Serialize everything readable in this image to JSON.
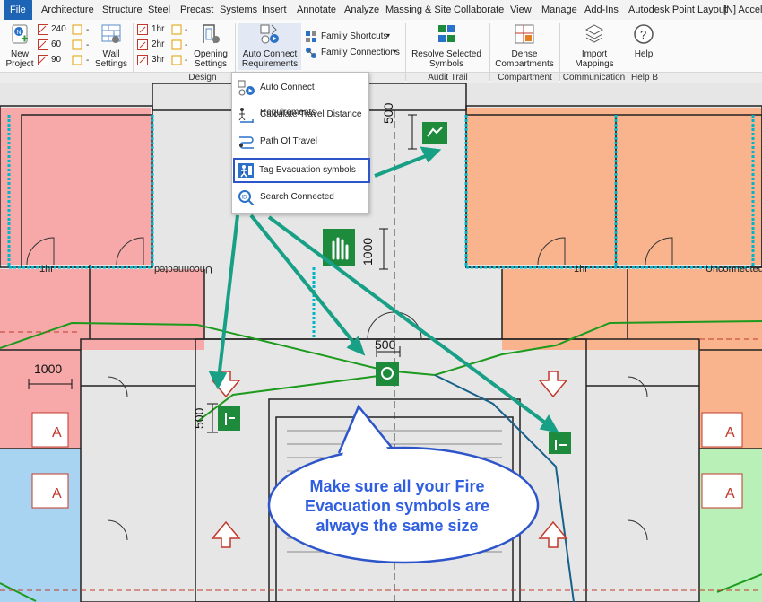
{
  "tabs": [
    "File",
    "Architecture",
    "Structure",
    "Steel",
    "Precast",
    "Systems",
    "Insert",
    "Annotate",
    "Analyze",
    "Massing & Site",
    "Collaborate",
    "View",
    "Manage",
    "Add-Ins",
    "Autodesk Point Layout",
    "[N] Accele"
  ],
  "ribbon": {
    "new_project": "New\nProject",
    "new_label_line1": "New",
    "new_label_line2": "Project",
    "counts": [
      "240",
      "60",
      "90"
    ],
    "wall_settings_1": "Wall",
    "wall_settings_2": "Settings",
    "hours": [
      "1hr",
      "2hr",
      "3hr"
    ],
    "dash": "-",
    "opening_1": "Opening",
    "opening_2": "Settings",
    "auto_1": "Auto Connect",
    "auto_2": "Requirements",
    "family_shortcuts": "Family Shortcuts",
    "family_connections": "Family Connections",
    "resolve_1": "Resolve Selected",
    "resolve_2": "Symbols",
    "dense_1": "Dense",
    "dense_2": "Compartments",
    "import_1": "Import",
    "import_2": "Mappings",
    "help": "Help",
    "groups": {
      "design": "Design",
      "audit": "Audit Trail",
      "compartment": "Compartment",
      "communication": "Communication",
      "help": "Help B"
    }
  },
  "dropdown": [
    {
      "label": "Auto Connect Requirements",
      "icon": "auto-connect-icon"
    },
    {
      "label": "Calculate Travel Distance",
      "icon": "travel-distance-icon"
    },
    {
      "label": "Path Of Travel",
      "icon": "path-of-travel-icon"
    },
    {
      "label": "Tag Evacuation symbols",
      "icon": "tag-evacuation-icon"
    },
    {
      "label": "Search Connected",
      "icon": "search-connected-icon"
    }
  ],
  "plan": {
    "dims": {
      "d500_top": "500",
      "d1000_mid": "1000",
      "d1000_left": "1000",
      "d500_center": "500",
      "d500_left": "500"
    },
    "wall_tags": {
      "left_1hr": "1hr",
      "left_unc": "Unconnected",
      "right_1hr": "1hr",
      "right_unc": "Unconnected"
    },
    "room_tag": "A"
  },
  "callout": "Make sure all your Fire Evacuation symbols are always the same size",
  "colors": {
    "accent_blue": "#2d55c9",
    "callout_text": "#2f5fe0",
    "arrow_teal": "#17a085",
    "sign_green": "#1e8a3c",
    "path_green": "#1c9a1c"
  }
}
